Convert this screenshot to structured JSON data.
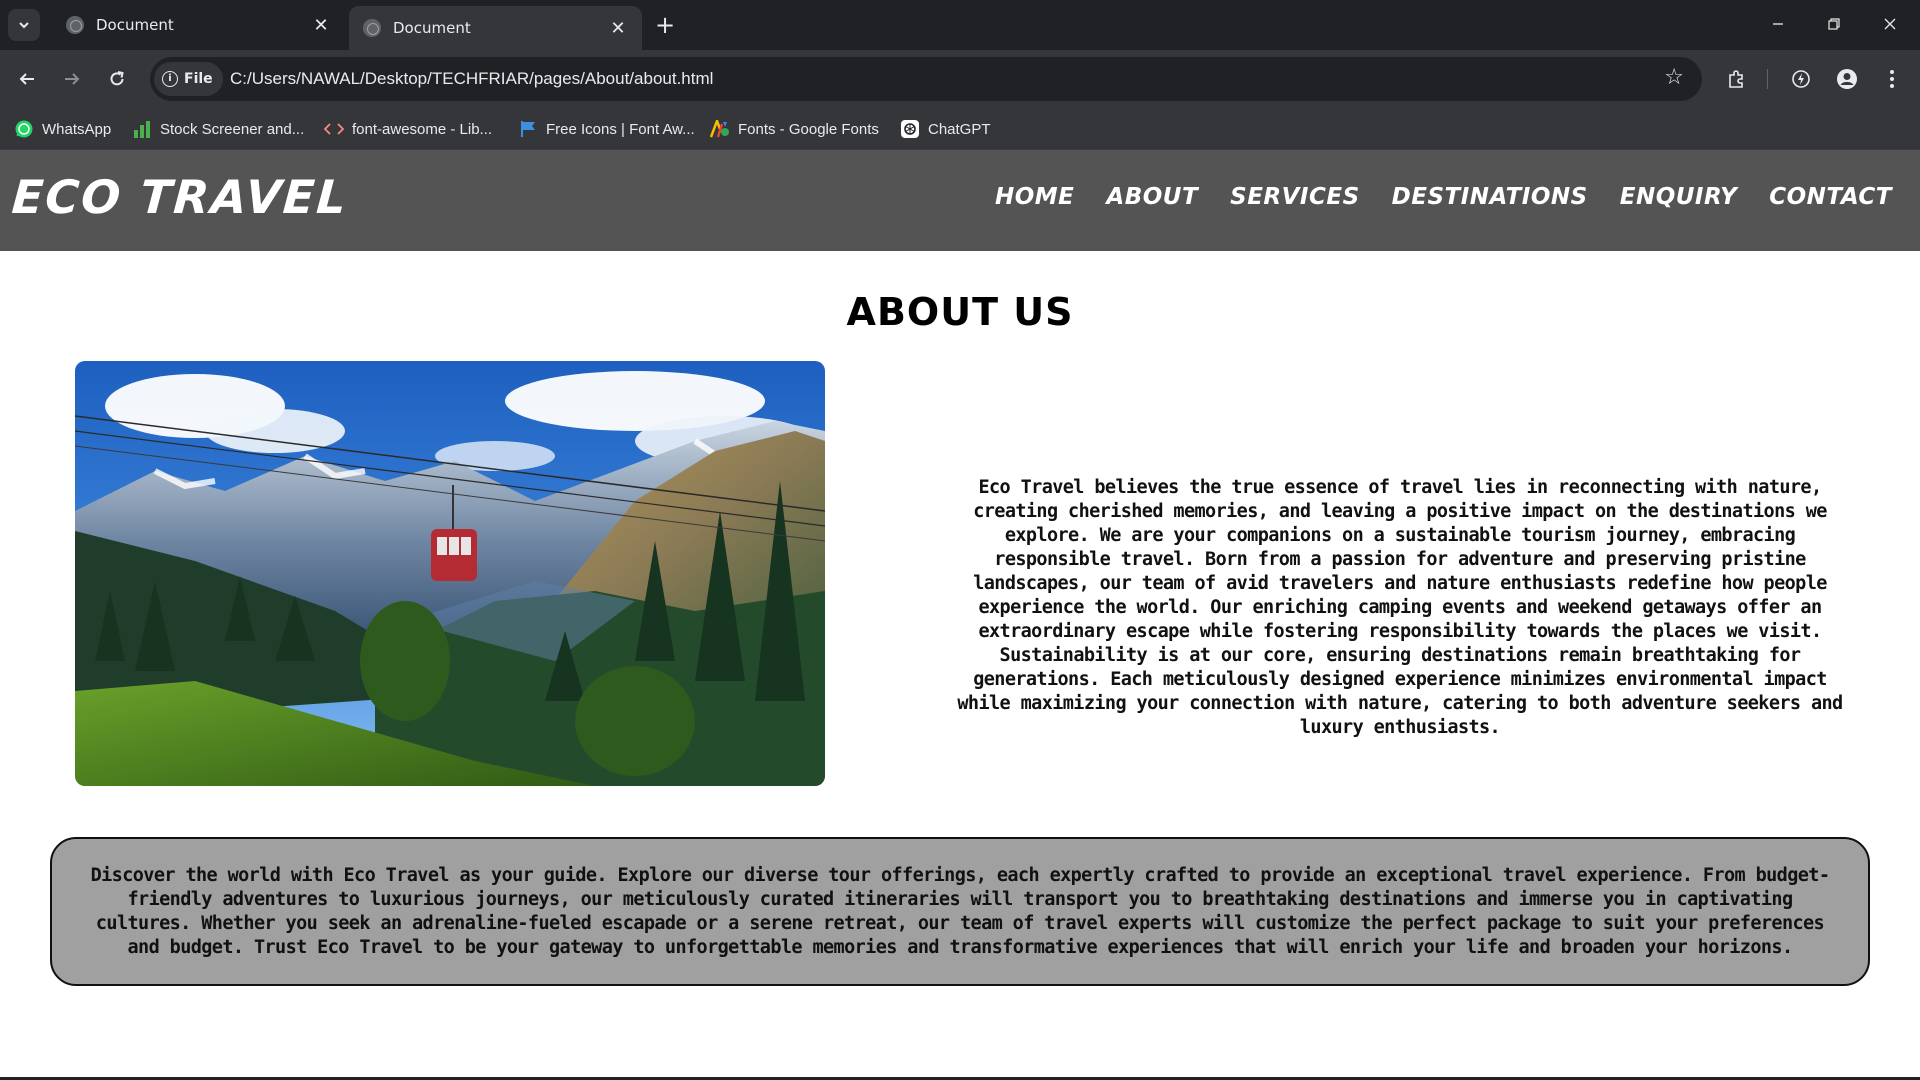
{
  "browser": {
    "tabs": [
      {
        "title": "Document",
        "active": false
      },
      {
        "title": "Document",
        "active": true
      }
    ],
    "new_tab_symbol": "+",
    "file_chip": "File",
    "url": "C:/Users/NAWAL/Desktop/TECHFRIAR/pages/About/about.html",
    "bookmarks": [
      {
        "label": "WhatsApp",
        "icon": "whatsapp-icon"
      },
      {
        "label": "Stock Screener and...",
        "icon": "bar-chart-icon"
      },
      {
        "label": "font-awesome - Lib...",
        "icon": "code-icon"
      },
      {
        "label": "Free Icons | Font Aw...",
        "icon": "flag-icon"
      },
      {
        "label": "Fonts - Google Fonts",
        "icon": "google-fonts-icon"
      },
      {
        "label": "ChatGPT",
        "icon": "chatgpt-icon"
      }
    ]
  },
  "site": {
    "logo": "ECO TRAVEL",
    "nav": [
      "HOME",
      "ABOUT",
      "SERVICES",
      "DESTINATIONS",
      "ENQUIRY",
      "CONTACT"
    ],
    "page_title": "ABOUT US",
    "about_text": "Eco Travel believes the true essence of travel lies in reconnecting with nature, creating cherished memories, and leaving a positive impact on the destinations we explore. We are your companions on a sustainable tourism journey, embracing responsible travel. Born from a passion for adventure and preserving pristine landscapes, our team of avid travelers and nature enthusiasts redefine how people experience the world. Our enriching camping events and weekend getaways offer an extraordinary escape while fostering responsibility towards the places we visit. Sustainability is at our core, ensuring destinations remain breathtaking for generations. Each meticulously designed experience minimizes environmental impact while maximizing your connection with nature, catering to both adventure seekers and luxury enthusiasts.",
    "discover_text": "Discover the world with Eco Travel as your guide. Explore our diverse tour offerings, each expertly crafted to provide an exceptional travel experience. From budget-friendly adventures to luxurious journeys, our meticulously curated itineraries will transport you to breathtaking destinations and immerse you in captivating cultures. Whether you seek an adrenaline-fueled escapade or a serene retreat, our team of travel experts will customize the perfect package to suit your preferences and budget. Trust Eco Travel to be your gateway to unforgettable memories and transformative experiences that will enrich your life and broaden your horizons."
  },
  "colors": {
    "header_bg": "#545454",
    "discover_bg": "#a0a0a0",
    "chrome_dark": "#202124",
    "chrome_mid": "#35363a"
  }
}
